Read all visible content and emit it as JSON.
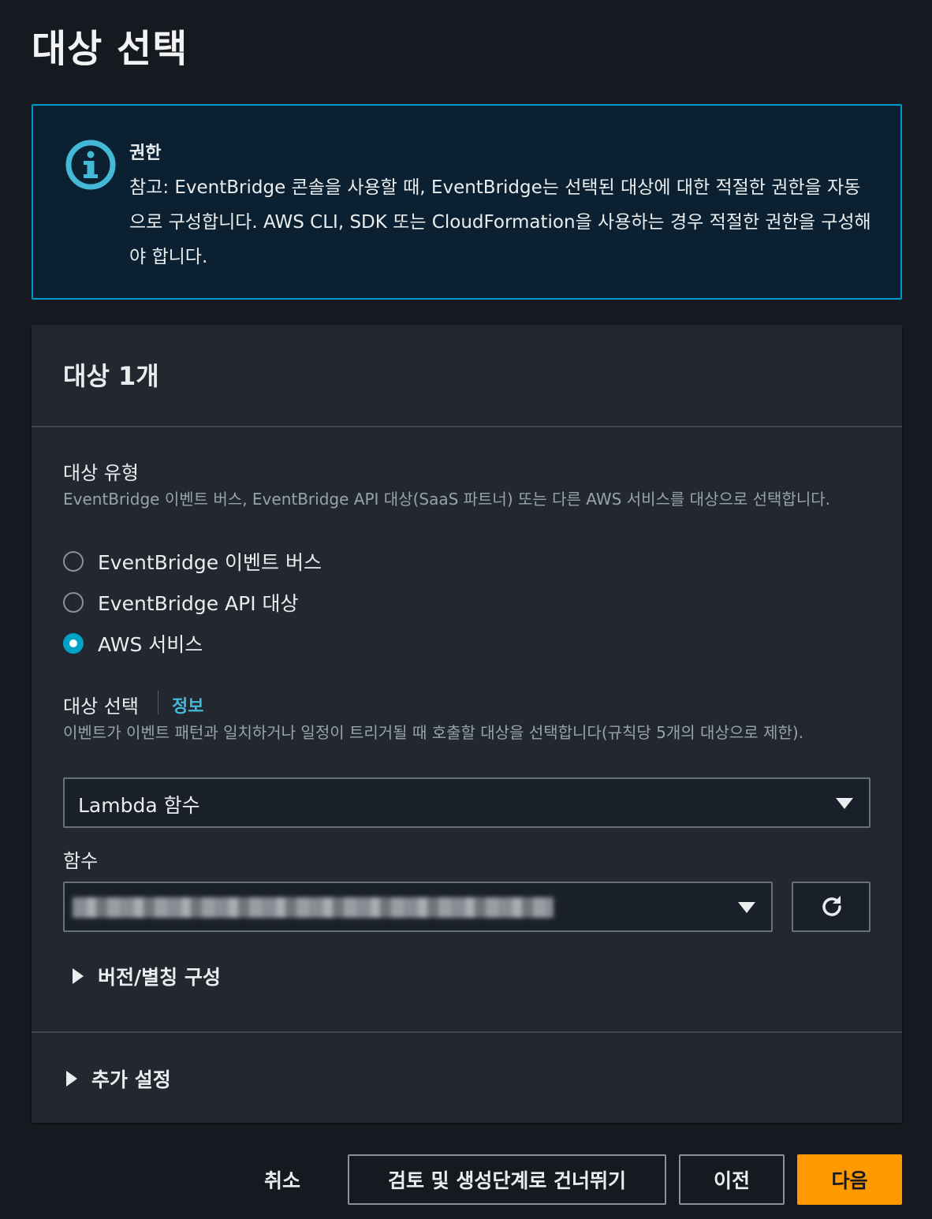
{
  "page": {
    "title": "대상 선택"
  },
  "alert": {
    "icon": "info-circle-icon",
    "title": "권한",
    "text": "참고: EventBridge 콘솔을 사용할 때, EventBridge는 선택된 대상에 대한 적절한 권한을 자동으로 구성합니다. AWS CLI, SDK 또는 CloudFormation을 사용하는 경우 적절한 권한을 구성해야 합니다."
  },
  "panel": {
    "title": "대상 1개",
    "target_type": {
      "label": "대상 유형",
      "description": "EventBridge 이벤트 버스, EventBridge API 대상(SaaS 파트너) 또는 다른 AWS 서비스를 대상으로 선택합니다.",
      "options": [
        {
          "label": "EventBridge 이벤트 버스",
          "checked": false
        },
        {
          "label": "EventBridge API 대상",
          "checked": false
        },
        {
          "label": "AWS 서비스",
          "checked": true
        }
      ]
    },
    "select_target": {
      "label": "대상 선택",
      "info_link": "정보",
      "description": "이벤트가 이벤트 패턴과 일치하거나 일정이 트리거될 때 호출할 대상을 선택합니다(규칙당 5개의 대상으로 제한).",
      "value": "Lambda 함수"
    },
    "function": {
      "label": "함수",
      "value_redacted": true
    },
    "version_alias": {
      "label": "버전/별칭 구성"
    },
    "additional_settings": {
      "label": "추가 설정"
    }
  },
  "footer": {
    "cancel": "취소",
    "skip": "검토 및 생성단계로 건너뛰기",
    "previous": "이전",
    "next": "다음"
  },
  "colors": {
    "accent": "#00a1c9",
    "primary_button": "#ff9900",
    "info_border": "#0099cc"
  }
}
